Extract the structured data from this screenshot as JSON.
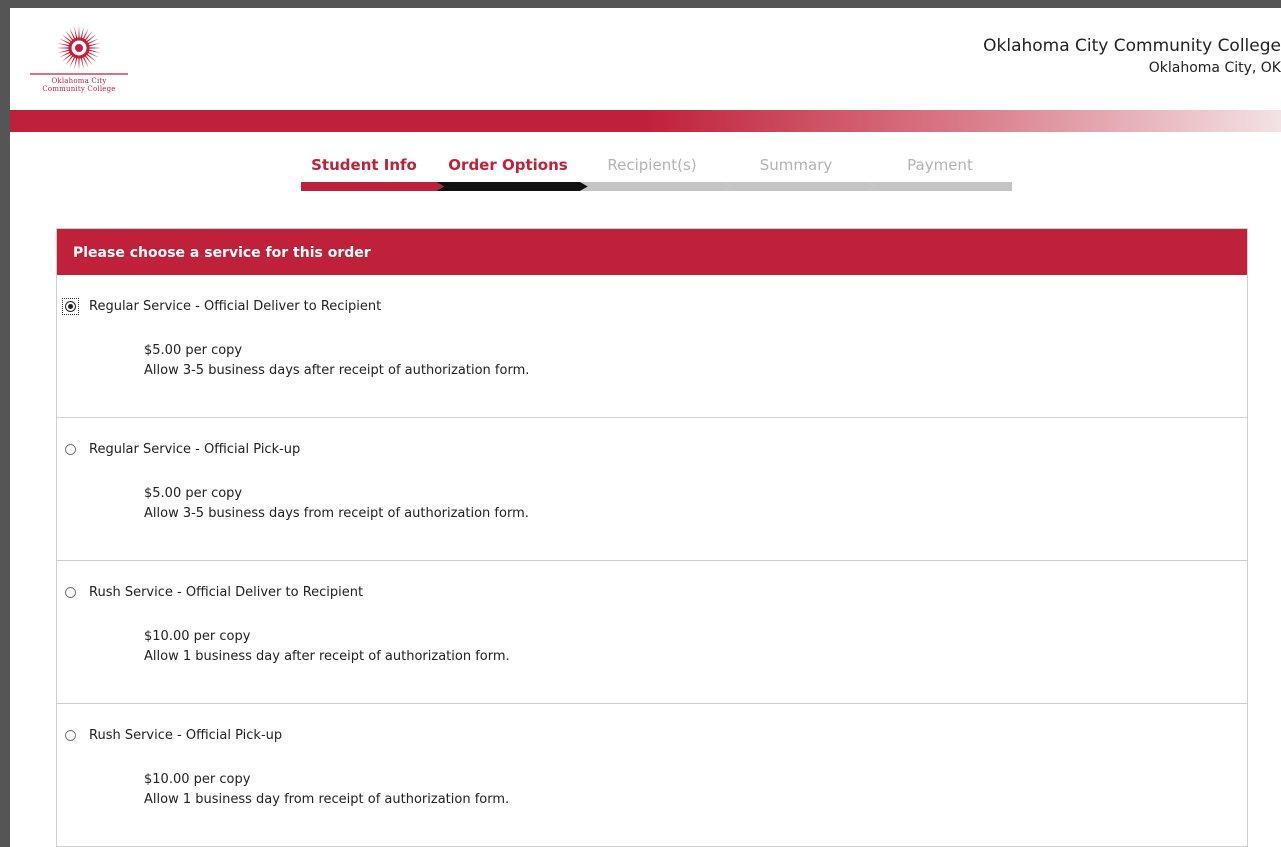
{
  "header": {
    "logo_line1": "Oklahoma City",
    "logo_line2": "Community College",
    "school_name": "Oklahoma City Community College",
    "location": "Oklahoma City, OK"
  },
  "steps": [
    {
      "label": "Student Info",
      "state": "done"
    },
    {
      "label": "Order Options",
      "state": "current"
    },
    {
      "label": "Recipient(s)",
      "state": "todo"
    },
    {
      "label": "Summary",
      "state": "todo"
    },
    {
      "label": "Payment",
      "state": "todo"
    }
  ],
  "panel": {
    "title": "Please choose a service for this order",
    "options": [
      {
        "title": "Regular Service - Official Deliver to Recipient",
        "price": "$5.00 per copy",
        "note": "Allow 3-5 business days after receipt of authorization form.",
        "selected": true
      },
      {
        "title": "Regular Service - Official Pick-up",
        "price": "$5.00 per copy",
        "note": "Allow 3-5 business days from receipt of authorization form.",
        "selected": false
      },
      {
        "title": "Rush Service - Official Deliver to Recipient",
        "price": "$10.00 per copy",
        "note": "Allow 1 business day after receipt of authorization form.",
        "selected": false
      },
      {
        "title": "Rush Service - Official Pick-up",
        "price": "$10.00 per copy",
        "note": "Allow 1 business day from receipt of authorization form.",
        "selected": false
      }
    ]
  },
  "colors": {
    "brand": "#c0213a",
    "step_current_bar": "#111111",
    "step_todo_bar": "#c4c4c4",
    "step_todo_text": "#b3b3b3"
  },
  "icons": {
    "logo": "sunburst-emblem-icon"
  }
}
